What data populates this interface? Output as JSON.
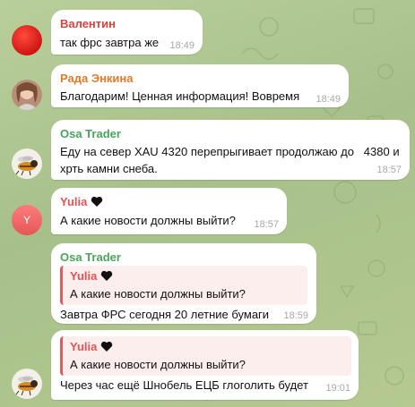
{
  "messages": [
    {
      "sender": "Валентин",
      "text": "так фрс завтра же",
      "time": "18:49",
      "name_color": "#d6453d"
    },
    {
      "sender": "Рада Энкина",
      "text": "Благодарим! Ценная информация! Вовремя",
      "time": "18:49",
      "name_color": "#e07a2c"
    },
    {
      "sender": "Osa Trader",
      "text_line1": "Еду на север XAU 4320 перепрыгивает продолжаю до   4380 и",
      "text_line2": "хрть камни снеба.",
      "time": "18:57",
      "name_color": "#4aa35b"
    },
    {
      "sender": "Yulia",
      "text": "А какие новости должны выйти?",
      "time": "18:57",
      "name_color": "#e05454",
      "avatar_letter": "Y"
    },
    {
      "sender": "Osa Trader",
      "quote_sender": "Yulia",
      "quote_text": "А какие новости должны выйти?",
      "text": "Завтра ФРС сегодня 20 летние бумаги",
      "time": "18:59",
      "name_color": "#4aa35b"
    },
    {
      "quote_sender": "Yulia",
      "quote_text": "А какие новости должны выйти?",
      "text": "Через час ещё Шнобель ЕЦБ глоголить будет",
      "time": "19:01"
    }
  ],
  "icons": {
    "heart": "black-heart-emoji"
  }
}
